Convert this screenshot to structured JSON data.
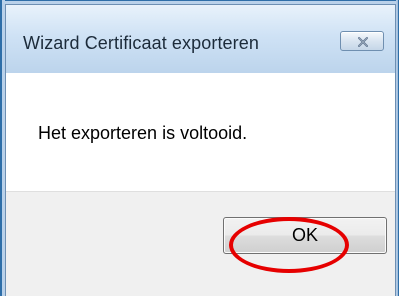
{
  "window": {
    "title": "Wizard Certificaat exporteren",
    "close_icon": "close-icon"
  },
  "content": {
    "message": "Het exporteren is voltooid."
  },
  "buttons": {
    "ok_label": "OK"
  },
  "annotation": {
    "highlight_color": "#e60000",
    "highlight_target": "ok-button"
  }
}
